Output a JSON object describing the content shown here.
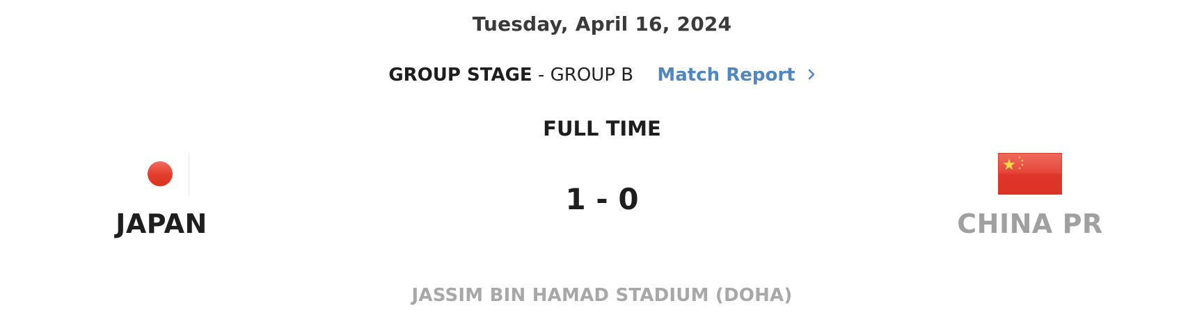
{
  "match": {
    "date": "Tuesday, April 16, 2024",
    "stage": "GROUP STAGE",
    "separator": "-",
    "group": "GROUP B",
    "match_report_label": "Match Report",
    "status": "FULL TIME",
    "score": "1 - 0",
    "venue": "JASSIM BIN HAMAD STADIUM (DOHA)"
  },
  "home_team": {
    "name": "JAPAN",
    "flag_icon": "japan-flag-icon"
  },
  "away_team": {
    "name": "CHINA PR",
    "flag_icon": "china-flag-icon"
  },
  "colors": {
    "link": "#4f87c3",
    "winner_text": "#1e1e1e",
    "loser_text": "#a0a0a0",
    "venue_text": "#a8a8a8",
    "japan_red": "#e0382a",
    "china_red": "#e0362a",
    "china_star": "#f6d94a"
  }
}
